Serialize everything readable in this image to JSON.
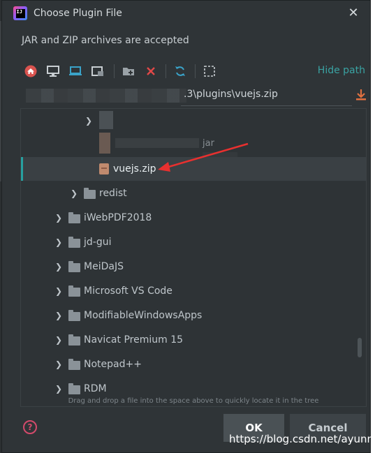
{
  "dialog": {
    "title": "Choose Plugin File",
    "subtitle": "JAR and ZIP archives are accepted",
    "close_glyph": "✕"
  },
  "toolbar": {
    "icons": [
      "home-icon",
      "desktop-icon",
      "project-icon",
      "module-icon",
      "new-folder-icon",
      "delete-icon",
      "refresh-icon",
      "show-hidden-icon"
    ],
    "hide_path_label": "Hide path"
  },
  "path": {
    "visible_text": ".3\\plugins\\vuejs.zip"
  },
  "tree": {
    "partial_fragment": "jar",
    "selected_file": "vuejs.zip",
    "items": [
      {
        "label": "redist"
      },
      {
        "label": "iWebPDF2018"
      },
      {
        "label": "jd-gui"
      },
      {
        "label": "MeiDaJS"
      },
      {
        "label": "Microsoft VS Code"
      },
      {
        "label": "ModifiableWindowsApps"
      },
      {
        "label": "Navicat Premium 15"
      },
      {
        "label": "Notepad++"
      },
      {
        "label": "RDM"
      }
    ]
  },
  "hint": "Drag and drop a file into the space above to quickly locate it in the tree",
  "buttons": {
    "help": "?",
    "ok": "OK",
    "cancel": "Cancel"
  },
  "watermark": "https://blog.csdn.net/ayunnuo",
  "colors": {
    "accent": "#27a0a0",
    "arrow": "#e8302f",
    "background": "#2f3437"
  }
}
